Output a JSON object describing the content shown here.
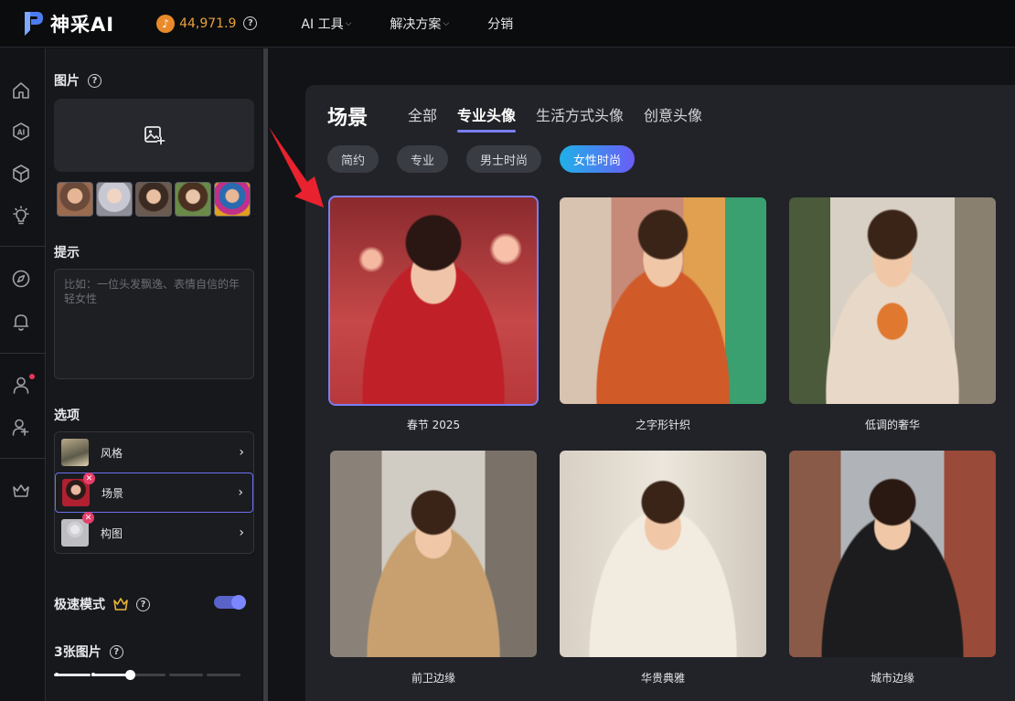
{
  "header": {
    "brand": "神采AI",
    "credits": "44,971.9",
    "nav": [
      {
        "label": "AI 工具",
        "has_dropdown": true
      },
      {
        "label": "解决方案",
        "has_dropdown": true
      },
      {
        "label": "分销",
        "has_dropdown": false
      }
    ]
  },
  "rail": {
    "icons": [
      "home-icon",
      "ai-icon",
      "cube-icon",
      "bulb-icon",
      "compass-icon",
      "bell-icon",
      "user-icon",
      "user-add-icon",
      "crown-icon"
    ]
  },
  "panel": {
    "images_title": "图片",
    "prompt_title": "提示",
    "prompt_placeholder": "比如：一位头发飘逸、表情自信的年轻女性",
    "options_title": "选项",
    "options": [
      {
        "label": "风格",
        "removable": false
      },
      {
        "label": "场景",
        "removable": true
      },
      {
        "label": "构图",
        "removable": true
      }
    ],
    "fast_mode_label": "极速模式",
    "fast_mode_on": true,
    "count_label": "3张图片",
    "count_value": 3
  },
  "scenes": {
    "title": "场景",
    "tabs": [
      {
        "label": "全部",
        "active": false
      },
      {
        "label": "专业头像",
        "active": true
      },
      {
        "label": "生活方式头像",
        "active": false
      },
      {
        "label": "创意头像",
        "active": false
      }
    ],
    "chips": [
      {
        "label": "简约",
        "active": false
      },
      {
        "label": "专业",
        "active": false
      },
      {
        "label": "男士时尚",
        "active": false
      },
      {
        "label": "女性时尚",
        "active": true
      }
    ],
    "items": [
      {
        "label": "春节 2025",
        "selected": true
      },
      {
        "label": "之字形针织",
        "selected": false
      },
      {
        "label": "低调的奢华",
        "selected": false
      },
      {
        "label": "前卫边缘",
        "selected": false
      },
      {
        "label": "华贵典雅",
        "selected": false
      },
      {
        "label": "城市边缘",
        "selected": false
      }
    ]
  },
  "colors": {
    "accent": "#7b7ff3",
    "credit": "#e8a13c",
    "badge": "#e53e6a"
  }
}
